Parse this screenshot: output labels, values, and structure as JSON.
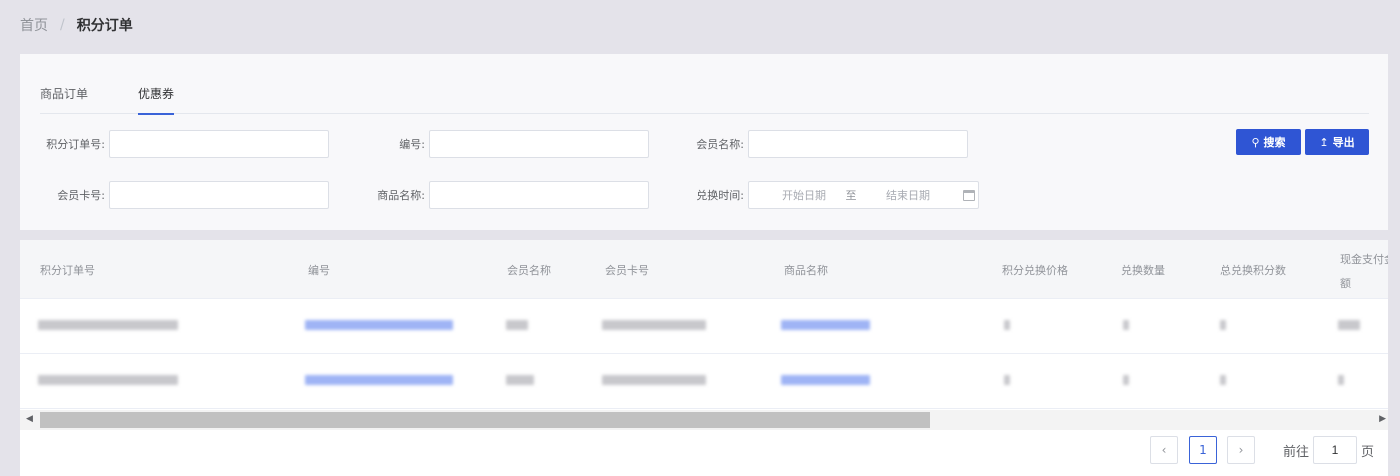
{
  "breadcrumb": {
    "home": "首页",
    "separator": "/",
    "current": "积分订单"
  },
  "tabs": [
    {
      "label": "商品订单"
    },
    {
      "label": "优惠券",
      "active": true
    }
  ],
  "filters": {
    "order_no": {
      "label": "积分订单号:",
      "value": ""
    },
    "code": {
      "label": "编号:",
      "value": ""
    },
    "member_name": {
      "label": "会员名称:",
      "value": ""
    },
    "card_no": {
      "label": "会员卡号:",
      "value": ""
    },
    "product_name": {
      "label": "商品名称:",
      "value": ""
    },
    "exchange_time": {
      "label": "兑换时间:",
      "start_placeholder": "开始日期",
      "separator": "至",
      "end_placeholder": "结束日期"
    }
  },
  "buttons": {
    "search": "搜索",
    "export": "导出"
  },
  "table": {
    "columns": [
      "积分订单号",
      "编号",
      "会员名称",
      "会员卡号",
      "商品名称",
      "积分兑换价格",
      "兑换数量",
      "总兑换积分数",
      "现金支付金",
      "额"
    ]
  },
  "pagination": {
    "current_page": "1",
    "goto_label": "前往",
    "goto_value": "1",
    "page_suffix": "页"
  },
  "colors": {
    "primary": "#2f55d4",
    "accent": "#3a63d8"
  }
}
